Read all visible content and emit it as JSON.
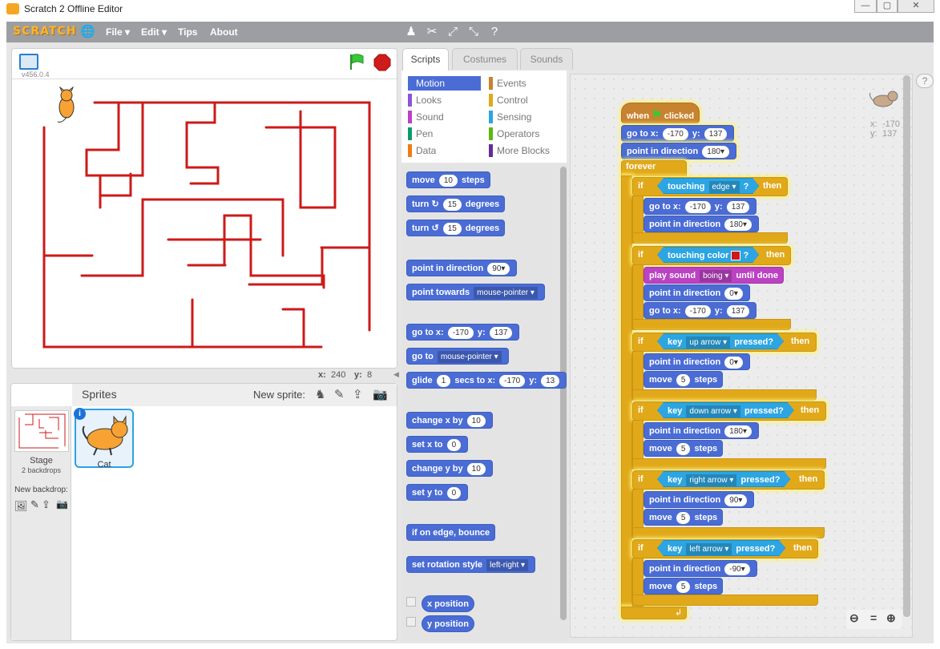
{
  "window": {
    "title": "Scratch 2 Offline Editor"
  },
  "menu": {
    "logo": "SCRATCH",
    "items": [
      "File ▾",
      "Edit ▾",
      "Tips",
      "About"
    ]
  },
  "stage": {
    "version": "v456.0.4",
    "readout_x_label": "x:",
    "readout_x": "240",
    "readout_y_label": "y:",
    "readout_y": "8"
  },
  "sprites": {
    "header": "Sprites",
    "new_sprite": "New sprite:",
    "stage_label": "Stage",
    "stage_sub": "2 backdrops",
    "new_backdrop": "New backdrop:",
    "sprite_name": "Cat"
  },
  "tabs": [
    "Scripts",
    "Costumes",
    "Sounds"
  ],
  "categories": {
    "left": [
      "Motion",
      "Looks",
      "Sound",
      "Pen",
      "Data"
    ],
    "right": [
      "Events",
      "Control",
      "Sensing",
      "Operators",
      "More Blocks"
    ],
    "colors": {
      "Motion": "#4a6cd4",
      "Looks": "#8a55d7",
      "Sound": "#bb42c3",
      "Pen": "#0e9a6c",
      "Data": "#ee7d16",
      "Events": "#c88330",
      "Control": "#e1a91a",
      "Sensing": "#2ca5e2",
      "Operators": "#5cb712",
      "More Blocks": "#632d99"
    }
  },
  "palette": {
    "move": "move",
    "move_v": "10",
    "move_t": "steps",
    "turn": "turn",
    "turn_r": "↻",
    "turn_l": "↺",
    "turn_v": "15",
    "degrees": "degrees",
    "point_dir": "point in direction",
    "point_dir_v": "90▾",
    "point_towards": "point towards",
    "towards_v": "mouse-pointer ▾",
    "goto": "go to x:",
    "goto_x": "-170",
    "y": "y:",
    "goto_y": "137",
    "goto_to": "go to",
    "goto_to_v": "mouse-pointer ▾",
    "glide": "glide",
    "glide_v": "1",
    "glide_t": "secs to x:",
    "glide_x": "-170",
    "glide_y_label": "y:",
    "glide_y": "13",
    "change_x": "change x by",
    "change_x_v": "10",
    "set_x": "set x to",
    "set_x_v": "0",
    "change_y": "change y by",
    "change_y_v": "10",
    "set_y": "set y to",
    "set_y_v": "0",
    "bounce": "if on edge, bounce",
    "rot_style": "set rotation style",
    "rot_v": "left-right ▾",
    "xpos": "x position",
    "ypos": "y position"
  },
  "script": {
    "hat_when": "when",
    "hat_clicked": "clicked",
    "goto": "go to x:",
    "x": "-170",
    "y_label": "y:",
    "y": "137",
    "point_dir": "point in direction",
    "dir180": "180▾",
    "dir0": "0▾",
    "dir90": "90▾",
    "dirm90": "-90▾",
    "forever": "forever",
    "if": "if",
    "then": "then",
    "touching": "touching",
    "edge": "edge ▾",
    "q": "?",
    "touching_color": "touching color",
    "play_sound": "play sound",
    "boing": "boing ▾",
    "until_done": "until done",
    "key": "key",
    "pressed": "pressed?",
    "up": "up arrow ▾",
    "down": "down arrow ▾",
    "right": "right arrow ▾",
    "left": "left arrow ▾",
    "move": "move",
    "five": "5",
    "steps": "steps",
    "loop": "↲"
  },
  "sprite_info": {
    "x_label": "x:",
    "x": "-170",
    "y_label": "y:",
    "y": "137"
  },
  "zoom": {
    "out": "🔍-",
    "reset": "=",
    "in": "🔍+"
  }
}
